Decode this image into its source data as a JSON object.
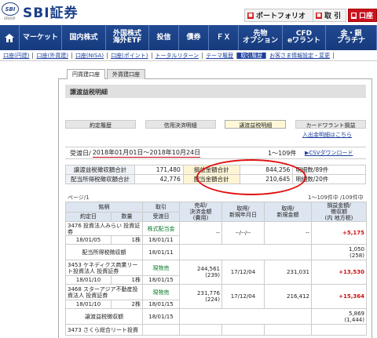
{
  "header": {
    "logo_mark": "SBI",
    "logo_group": "GROUP",
    "logo_text": "SBI証券",
    "buttons": [
      {
        "label": "ポートフォリオ",
        "icon": "portfolio-icon"
      },
      {
        "label": "取 引",
        "icon": "trade-icon"
      },
      {
        "label": "口座",
        "icon": "account-icon"
      }
    ]
  },
  "main_nav": [
    "マーケット",
    "国内株式",
    "外国株式\n海外ETF",
    "投信",
    "債券",
    "ＦＸ",
    "先物\nオプション",
    "CFD\neワラント",
    "金・銀\nプラチナ"
  ],
  "sub_nav": [
    "口座(円建)",
    "口座(外貨建)",
    "口座(NISA)",
    "口座(ポイント)",
    "トータルリターン",
    "テーマ履歴",
    "取引履歴",
    "お客さま情報設定・変更"
  ],
  "sub_nav_active": 6,
  "tabs": [
    "円貨建口座",
    "外貨建口座"
  ],
  "panel_title": "譲渡益税明細",
  "kind_tabs": [
    "約定履歴",
    "信用決済明細",
    "譲渡益税明細",
    "カードワラント損益"
  ],
  "kind_tabs_active": 2,
  "links": {
    "incoming": "入出金明細はこちら",
    "csv": "CSVダウンロード"
  },
  "period": {
    "label": "受渡日",
    "value": "2018年01月01日〜2018年10月24日",
    "count": "1〜109件"
  },
  "summary": [
    {
      "label1": "譲渡益税徴収額合計",
      "value1": "171,480",
      "label2": "損益金額合計",
      "value2": "844,256",
      "label3": "明細数/89件"
    },
    {
      "label1": "配当所得税徴収額合計",
      "value1": "42,776",
      "label2": "配当金額合計",
      "value2": "210,645",
      "label3": "明細数/20件"
    }
  ],
  "page_info": "ページ/1",
  "page_count": "1〜109件中 /109件中",
  "columns": {
    "h1": [
      "銘柄",
      "取引",
      "売却/\n決済金額",
      "取得/\n新規年月日",
      "取得/\n新規金額",
      "損益金額/\n徴収額"
    ],
    "h2": [
      "約定日",
      "数量",
      "受渡日",
      "(費用)",
      "",
      "",
      "(内 地方税)"
    ]
  },
  "rows": [
    {
      "name": "3476 投資法人みらい 投資証券",
      "date": "18/01/05",
      "qty": "1株",
      "trade": "株式配当金",
      "settle": "18/01/11",
      "amount": "--",
      "acq_date": "--/--/--",
      "acq_amount": "--",
      "pl": "+5,175",
      "pl_sign": "pos"
    },
    {
      "sub": true,
      "label": "配当所得税徴収額",
      "settle": "18/01/11",
      "tax": "1,050",
      "tax2": "(258)"
    },
    {
      "name": "3453 ケネディクス商業リート投資法人 投資証券",
      "date": "18/01/10",
      "qty": "1株",
      "trade": "現物売",
      "settle": "18/01/15",
      "amount": "244,561",
      "fee": "(239)",
      "acq_date": "17/12/04",
      "acq_amount": "231,031",
      "pl": "+13,530",
      "pl_sign": "pos"
    },
    {
      "name": "3468 スターアジア不動産投資法人 投資証券",
      "date": "18/01/10",
      "qty": "2株",
      "trade": "現物売",
      "settle": "18/01/15",
      "amount": "231,776",
      "fee": "(224)",
      "acq_date": "17/12/04",
      "acq_amount": "216,412",
      "pl": "+15,364",
      "pl_sign": "pos"
    },
    {
      "sub": true,
      "label": "譲渡益税徴収額",
      "settle": "18/01/15",
      "tax": "5,869",
      "tax2": "(1,444)"
    },
    {
      "name": "3473 さくら総合リート投資",
      "date": "",
      "qty": "",
      "trade": "",
      "settle": "",
      "amount": "",
      "acq_date": "",
      "acq_amount": "",
      "pl": "",
      "pl_sign": "pos"
    }
  ]
}
